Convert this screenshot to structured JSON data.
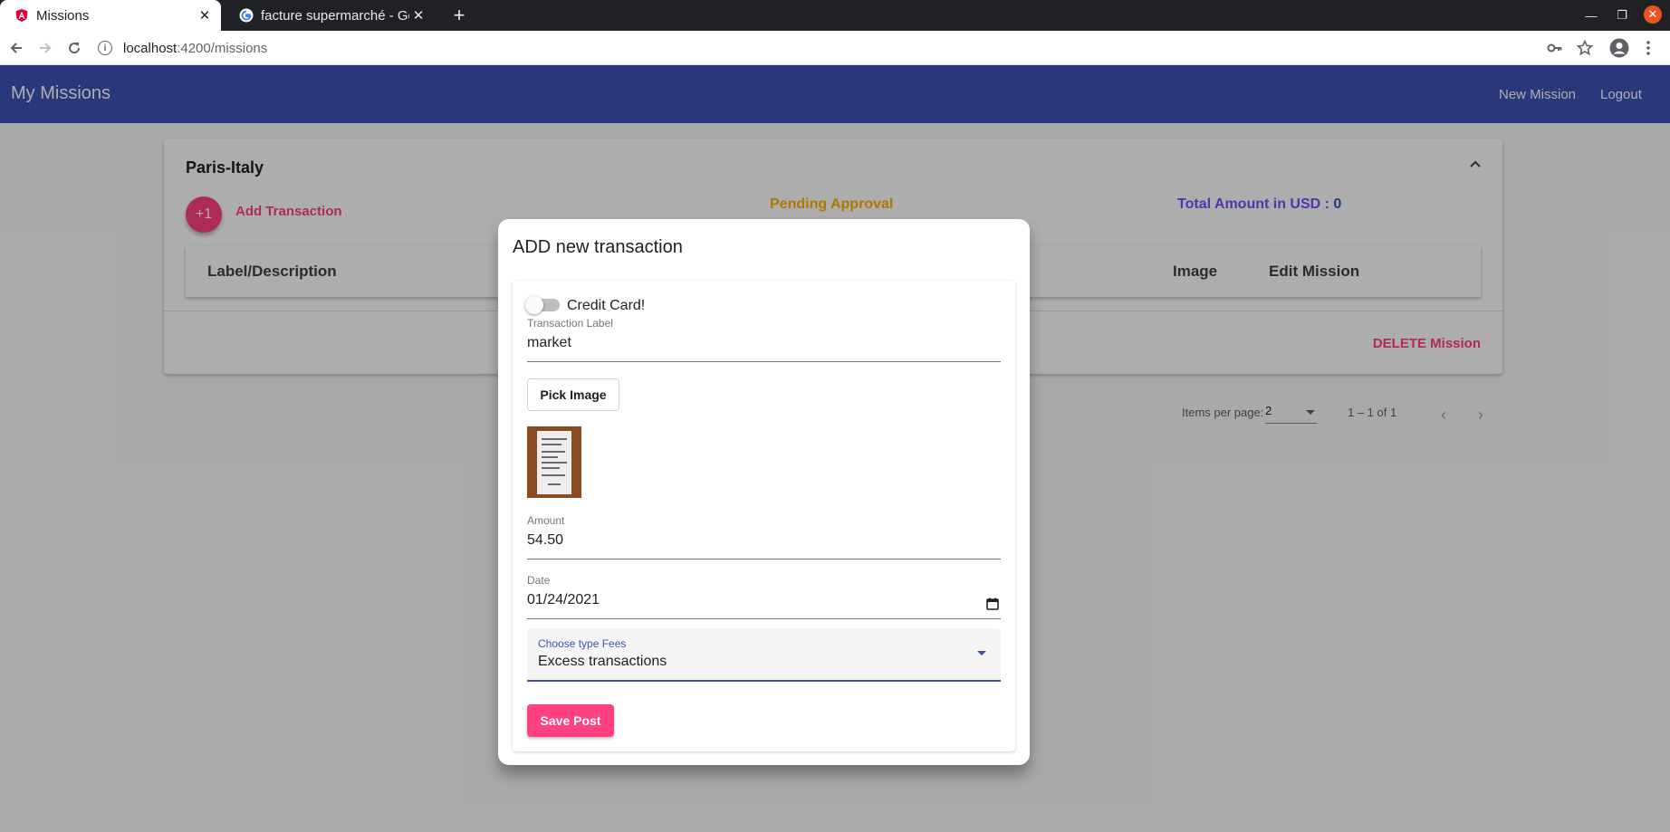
{
  "browser": {
    "tabs": [
      {
        "title": "Missions",
        "favicon": "angular-icon"
      },
      {
        "title": "facture supermarché - Go",
        "favicon": "google-icon"
      }
    ],
    "url": {
      "host": "localhost",
      "path": ":4200/missions"
    }
  },
  "header": {
    "title": "My Missions",
    "new_mission": "New Mission",
    "logout": "Logout",
    "color": "#3f51b5"
  },
  "mission": {
    "title": "Paris-Italy",
    "fab_label": "+1",
    "add_transaction": "Add Transaction",
    "status": "Pending Approval",
    "total_label": "Total Amount in USD : ",
    "total_value": "0",
    "columns": [
      "Label/Description",
      "Image",
      "Edit Mission"
    ],
    "delete": "DELETE Mission"
  },
  "paginator": {
    "items_per_page_label": "Items per page:",
    "page_size": "2",
    "range": "1 – 1 of 1"
  },
  "dialog": {
    "title": "ADD new transaction",
    "credit_card_label": "Credit Card!",
    "credit_card_on": false,
    "label_field": {
      "label": "Transaction Label",
      "value": "market"
    },
    "pick_image": "Pick Image",
    "amount_field": {
      "label": "Amount",
      "value": "54.50"
    },
    "date_field": {
      "label": "Date",
      "value": "01/24/2021"
    },
    "fees_select": {
      "label": "Choose type Fees",
      "value": "Excess transactions"
    },
    "save": "Save Post"
  },
  "colors": {
    "accent": "#ff4081",
    "warn": "#ffb300",
    "purple": "#7c4dff"
  }
}
